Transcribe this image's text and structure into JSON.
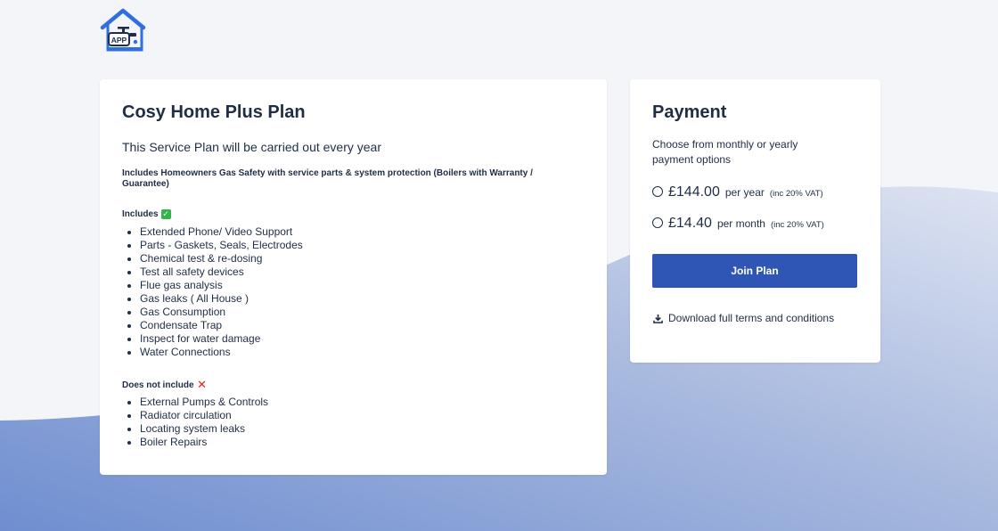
{
  "colors": {
    "accent": "#2f55b5",
    "background": "#f4f5f9",
    "text": "#1f2d45",
    "wave_start": "#6f8ed0",
    "wave_end": "#dde3f2"
  },
  "logo": {
    "text": "APP",
    "icon": "house-tap-icon"
  },
  "plan": {
    "title": "Cosy Home Plus Plan",
    "frequency": "This Service Plan will be carried out every year",
    "includes_note": "Includes Homeowners Gas Safety with service parts & system protection (Boilers with Warranty / Guarantee)",
    "includes_heading": "Includes",
    "includes_icon": "check-icon",
    "includes": [
      "Extended Phone/ Video Support",
      "Parts - Gaskets, Seals, Electrodes",
      "Chemical test & re-dosing",
      "Test all safety devices",
      "Flue gas analysis",
      "Gas leaks ( All House )",
      "Gas Consumption",
      "Condensate Trap",
      "Inspect for water damage",
      "Water Connections"
    ],
    "excludes_heading": "Does not include",
    "excludes_icon": "cross-icon",
    "excludes": [
      "External Pumps & Controls",
      "Radiator circulation",
      "Locating system leaks",
      "Boiler Repairs"
    ]
  },
  "payment": {
    "title": "Payment",
    "description": "Choose from monthly or yearly payment options",
    "options": [
      {
        "price": "£144.00",
        "period": "per year",
        "vat": "(inc 20% VAT)"
      },
      {
        "price": "£14.40",
        "period": "per month",
        "vat": "(inc 20% VAT)"
      }
    ],
    "join_label": "Join Plan",
    "terms_label": "Download full terms and conditions",
    "terms_icon": "download-icon"
  }
}
